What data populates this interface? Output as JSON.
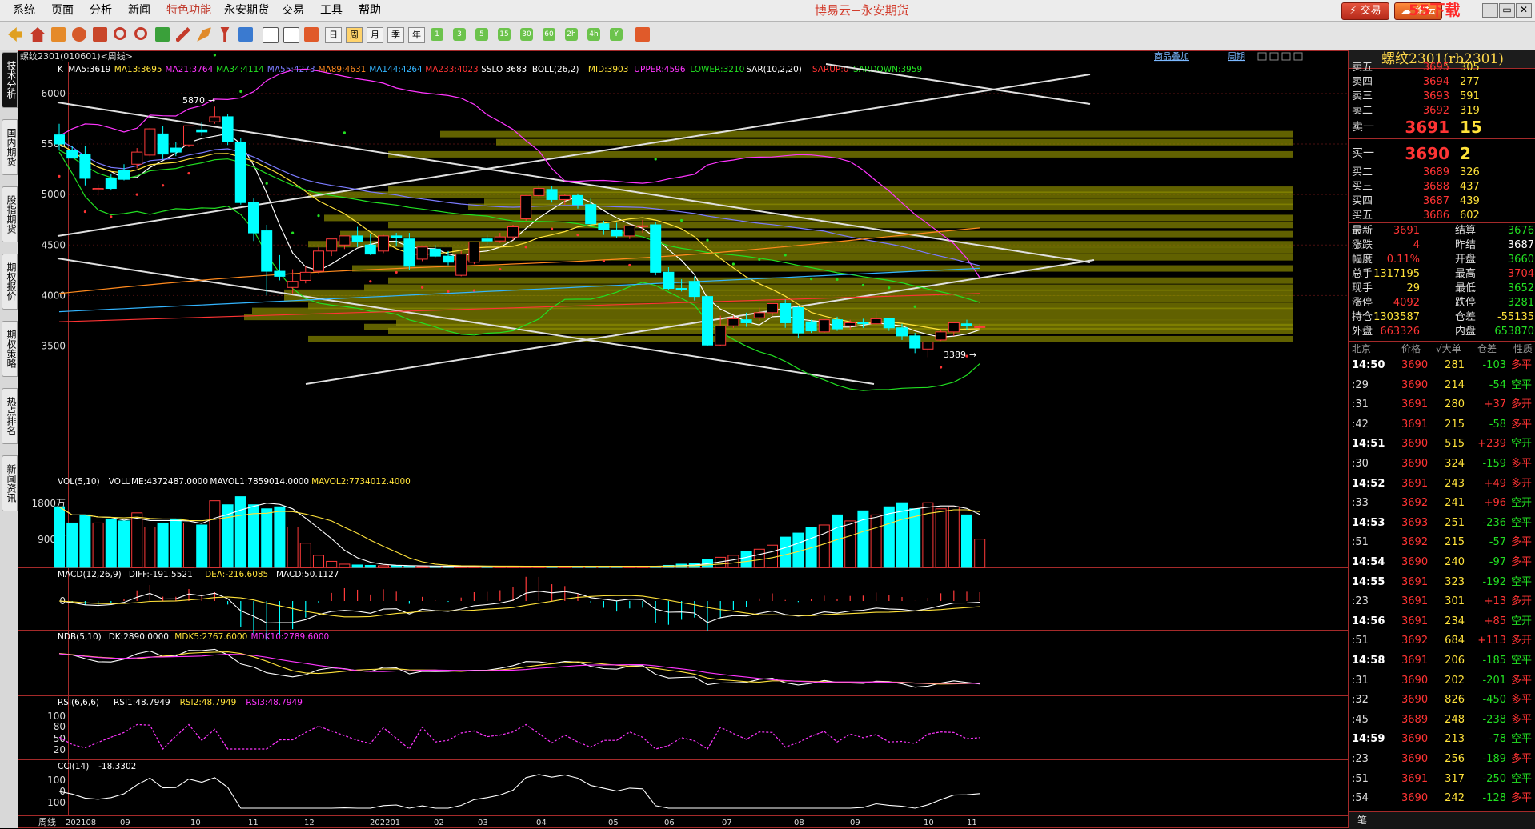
{
  "menu": {
    "items": [
      "系统",
      "页面",
      "分析",
      "新闻",
      "特色功能",
      "永安期货",
      "交易",
      "工具",
      "帮助"
    ],
    "title": "博易云−永安期货",
    "trade_btn": "交易",
    "forum_btn": "论坛",
    "watermark": "55下载 55etz.com"
  },
  "toolbar": {
    "periods": [
      "日",
      "周",
      "月",
      "季",
      "年",
      "1",
      "3",
      "5",
      "15",
      "30",
      "60",
      "2h",
      "4h",
      "Y"
    ]
  },
  "left_tabs": [
    "技术分析",
    "国内期货",
    "股指期货",
    "期权报价",
    "期权策略",
    "热点排名",
    "新闻资讯"
  ],
  "chart": {
    "symbol_title": "螺纹2301(010601)<周线>",
    "toplinks": [
      "商品叠加",
      "周期"
    ],
    "main_header": [
      {
        "t": "K",
        "c": "#ffffff"
      },
      {
        "t": "MA5:3619",
        "c": "#ffffff"
      },
      {
        "t": "MA13:3695",
        "c": "#ffe23a"
      },
      {
        "t": "MA21:3764",
        "c": "#ff35ff"
      },
      {
        "t": "MA34:4114",
        "c": "#22e022"
      },
      {
        "t": "MA55:4273",
        "c": "#7b7bff"
      },
      {
        "t": "MA89:4631",
        "c": "#ff8a1e"
      },
      {
        "t": "MA144:4264",
        "c": "#33b5ff"
      },
      {
        "t": "MA233:4023",
        "c": "#ff3434"
      },
      {
        "t": "SSLO 3683",
        "c": "#ffffff"
      },
      {
        "t": "BOLL(26,2)",
        "c": "#ffffff"
      },
      {
        "t": "MID:3903",
        "c": "#ffe23a"
      },
      {
        "t": "UPPER:4596",
        "c": "#ff35ff"
      },
      {
        "t": "LOWER:3210",
        "c": "#22e022"
      },
      {
        "t": "SAR(10,2,20)",
        "c": "#ffffff"
      },
      {
        "t": "SARUP:0",
        "c": "#ff3434"
      },
      {
        "t": "SARDOWN:3959",
        "c": "#22e022"
      }
    ],
    "price_ticks": [
      "6000",
      "5500",
      "5000",
      "4500",
      "4000",
      "3500"
    ],
    "annotations": {
      "high": "5870",
      "low": "3389"
    },
    "vol_header": [
      {
        "t": "VOL(5,10)",
        "c": "#ffffff"
      },
      {
        "t": "VOLUME:4372487.0000",
        "c": "#ffffff"
      },
      {
        "t": "MAVOL1:7859014.0000",
        "c": "#ffffff"
      },
      {
        "t": "MAVOL2:7734012.4000",
        "c": "#ffe23a"
      }
    ],
    "vol_ticks": [
      "1800万",
      "900万"
    ],
    "macd_header": [
      {
        "t": "MACD(12,26,9)",
        "c": "#ffffff"
      },
      {
        "t": "DIFF:-191.5521",
        "c": "#ffffff"
      },
      {
        "t": "DEA:-216.6085",
        "c": "#ffe23a"
      },
      {
        "t": "MACD:50.1127",
        "c": "#ffffff"
      }
    ],
    "macd_ticks": [
      "0"
    ],
    "ndb_header": [
      {
        "t": "NDB(5,10)",
        "c": "#ffffff"
      },
      {
        "t": "DK:2890.0000",
        "c": "#ffffff"
      },
      {
        "t": "MDK5:2767.6000",
        "c": "#ffe23a"
      },
      {
        "t": "MDK10:2789.6000",
        "c": "#ff35ff"
      }
    ],
    "rsi_header": [
      {
        "t": "RSI(6,6,6)",
        "c": "#ffffff"
      },
      {
        "t": "RSI1:48.7949",
        "c": "#ffffff"
      },
      {
        "t": "RSI2:48.7949",
        "c": "#ffe23a"
      },
      {
        "t": "RSI3:48.7949",
        "c": "#ff35ff"
      }
    ],
    "rsi_ticks": [
      "100",
      "80",
      "50",
      "20"
    ],
    "cci_header": [
      {
        "t": "CCI(14)",
        "c": "#ffffff"
      },
      {
        "t": "-18.3302",
        "c": "#ffffff"
      }
    ],
    "cci_ticks": [
      "100",
      "0",
      "-100"
    ],
    "period_label": "周线",
    "x_labels": [
      "202108",
      "09",
      "10",
      "11",
      "12",
      "202201",
      "02",
      "03",
      "04",
      "05",
      "06",
      "07",
      "08",
      "09",
      "10",
      "11"
    ]
  },
  "chart_data": {
    "type": "candlestick",
    "candles": [
      [
        5590,
        5700,
        5500,
        5440
      ],
      [
        5440,
        5480,
        5360,
        5380
      ],
      [
        5400,
        5480,
        5160,
        5090
      ],
      [
        5050,
        5100,
        5060,
        4990
      ],
      [
        5160,
        5200,
        5060,
        5040
      ],
      [
        5240,
        5300,
        5150,
        5140
      ],
      [
        5300,
        5460,
        5420,
        5260
      ],
      [
        5390,
        5660,
        5650,
        5370
      ],
      [
        5600,
        5680,
        5400,
        5350
      ],
      [
        5460,
        5520,
        5420,
        5380
      ],
      [
        5490,
        5660,
        5680,
        5470
      ],
      [
        5640,
        5720,
        5620,
        5580
      ],
      [
        5720,
        5870,
        5770,
        5700
      ],
      [
        5770,
        5800,
        5520,
        5490
      ],
      [
        5520,
        5560,
        4920,
        4900
      ],
      [
        4920,
        4960,
        4620,
        4540
      ],
      [
        4640,
        4700,
        4240,
        4000
      ],
      [
        4240,
        4400,
        4190,
        4150
      ],
      [
        4080,
        4260,
        4140,
        4020
      ],
      [
        4150,
        4290,
        4230,
        4120
      ],
      [
        4240,
        4480,
        4440,
        4220
      ],
      [
        4440,
        4500,
        4560,
        4390
      ],
      [
        4500,
        4560,
        4590,
        4460
      ],
      [
        4590,
        4680,
        4530,
        4480
      ],
      [
        4500,
        4610,
        4410,
        4400
      ],
      [
        4440,
        4600,
        4590,
        4420
      ],
      [
        4590,
        4620,
        4570,
        4490
      ],
      [
        4560,
        4620,
        4290,
        4250
      ],
      [
        4360,
        4460,
        4480,
        4340
      ],
      [
        4460,
        4500,
        4390,
        4380
      ],
      [
        4390,
        4440,
        4330,
        4300
      ],
      [
        4200,
        4440,
        4410,
        4190
      ],
      [
        4330,
        4460,
        4530,
        4310
      ],
      [
        4560,
        4600,
        4540,
        4500
      ],
      [
        4540,
        4620,
        4580,
        4520
      ],
      [
        4580,
        4700,
        4680,
        4550
      ],
      [
        4760,
        4800,
        4990,
        4740
      ],
      [
        4990,
        5100,
        5060,
        4960
      ],
      [
        5050,
        5080,
        4950,
        4920
      ],
      [
        4950,
        5000,
        4990,
        4900
      ],
      [
        4990,
        5010,
        4900,
        4860
      ],
      [
        4900,
        4960,
        4710,
        4680
      ],
      [
        4710,
        4740,
        4650,
        4600
      ],
      [
        4650,
        4720,
        4590,
        4570
      ],
      [
        4590,
        4680,
        4690,
        4560
      ],
      [
        4690,
        4750,
        4690,
        4620
      ],
      [
        4700,
        4730,
        4230,
        4200
      ],
      [
        4230,
        4280,
        4070,
        4050
      ],
      [
        4070,
        4160,
        4060,
        4040
      ],
      [
        4140,
        4190,
        3990,
        3950
      ],
      [
        3990,
        4000,
        3510,
        3500
      ],
      [
        3510,
        3800,
        3700,
        3500
      ],
      [
        3700,
        3800,
        3770,
        3680
      ],
      [
        3760,
        3830,
        3730,
        3690
      ],
      [
        3780,
        3880,
        3830,
        3750
      ],
      [
        3830,
        3890,
        3920,
        3800
      ],
      [
        3920,
        3960,
        3730,
        3680
      ],
      [
        3880,
        3900,
        3630,
        3580
      ],
      [
        3740,
        3760,
        3650,
        3630
      ],
      [
        3640,
        3710,
        3760,
        3630
      ],
      [
        3760,
        3790,
        3670,
        3650
      ],
      [
        3700,
        3760,
        3730,
        3660
      ],
      [
        3730,
        3770,
        3720,
        3680
      ],
      [
        3720,
        3840,
        3770,
        3710
      ],
      [
        3770,
        3780,
        3680,
        3650
      ],
      [
        3680,
        3720,
        3600,
        3560
      ],
      [
        3600,
        3630,
        3480,
        3430
      ],
      [
        3470,
        3520,
        3540,
        3389
      ],
      [
        3560,
        3660,
        3640,
        3550
      ],
      [
        3640,
        3740,
        3730,
        3600
      ],
      [
        3720,
        3760,
        3700,
        3660
      ],
      [
        3690,
        3720,
        3691,
        3660
      ]
    ],
    "volume_wan": [
      1500,
      1100,
      1300,
      1100,
      1200,
      1150,
      1350,
      1000,
      1100,
      1200,
      1100,
      1050,
      1650,
      1550,
      1750,
      1550,
      1450,
      1500,
      1000,
      600,
      300,
      150,
      80,
      60,
      50,
      40,
      40,
      30,
      30,
      30,
      30,
      30,
      30,
      30,
      30,
      30,
      30,
      30,
      30,
      30,
      30,
      30,
      30,
      30,
      30,
      30,
      30,
      50,
      80,
      100,
      200,
      250,
      300,
      400,
      450,
      550,
      750,
      850,
      1000,
      1050,
      1300,
      1150,
      1400,
      1300,
      1500,
      1600,
      1450,
      1600,
      1450,
      1500,
      1300,
      700
    ],
    "ylim": [
      3100,
      6300
    ],
    "x_start": "202108"
  },
  "rpanel": {
    "title": "螺纹2301(rb2301)",
    "asks": [
      {
        "n": "卖五",
        "p": "3695",
        "v": "305"
      },
      {
        "n": "卖四",
        "p": "3694",
        "v": "277"
      },
      {
        "n": "卖三",
        "p": "3693",
        "v": "591"
      },
      {
        "n": "卖二",
        "p": "3692",
        "v": "319"
      },
      {
        "n": "卖一",
        "p": "3691",
        "v": "15"
      }
    ],
    "bids": [
      {
        "n": "买一",
        "p": "3690",
        "v": "2"
      },
      {
        "n": "买二",
        "p": "3689",
        "v": "326"
      },
      {
        "n": "买三",
        "p": "3688",
        "v": "437"
      },
      {
        "n": "买四",
        "p": "3687",
        "v": "439"
      },
      {
        "n": "买五",
        "p": "3686",
        "v": "602"
      }
    ],
    "stats": [
      {
        "l1": "最新",
        "v1": "3691",
        "c1": "#ff3434",
        "l2": "结算",
        "v2": "3676",
        "c2": "#22e022"
      },
      {
        "l1": "涨跌",
        "v1": "4",
        "c1": "#ff3434",
        "l2": "昨结",
        "v2": "3687",
        "c2": "#ffffff"
      },
      {
        "l1": "幅度",
        "v1": "0.11%",
        "c1": "#ff3434",
        "l2": "开盘",
        "v2": "3660",
        "c2": "#22e022"
      },
      {
        "l1": "总手",
        "v1": "1317195",
        "c1": "#ffe23a",
        "l2": "最高",
        "v2": "3704",
        "c2": "#ff3434"
      },
      {
        "l1": "现手",
        "v1": "29",
        "c1": "#ffe23a",
        "l2": "最低",
        "v2": "3652",
        "c2": "#22e022"
      },
      {
        "l1": "涨停",
        "v1": "4092",
        "c1": "#ff3434",
        "l2": "跌停",
        "v2": "3281",
        "c2": "#22e022"
      },
      {
        "l1": "持仓",
        "v1": "1303587",
        "c1": "#ffe23a",
        "l2": "仓差",
        "v2": "-55135",
        "c2": "#ffe23a"
      },
      {
        "l1": "外盘",
        "v1": "663326",
        "c1": "#ff3434",
        "l2": "内盘",
        "v2": "653870",
        "c2": "#22e022"
      }
    ],
    "ts_header": [
      "北京",
      "价格",
      "√大单",
      "仓差",
      "性质"
    ],
    "ticks": [
      {
        "t": "14:50",
        "p": "3690",
        "v": "281",
        "oi": "-103",
        "ty": "多平",
        "full": true
      },
      {
        "t": ":29",
        "p": "3690",
        "v": "214",
        "oi": "-54",
        "ty": "空平",
        "full": false
      },
      {
        "t": ":31",
        "p": "3691",
        "v": "280",
        "oi": "+37",
        "ty": "多开",
        "full": false
      },
      {
        "t": ":42",
        "p": "3691",
        "v": "215",
        "oi": "-58",
        "ty": "多平",
        "full": false
      },
      {
        "t": "14:51",
        "p": "3690",
        "v": "515",
        "oi": "+239",
        "ty": "空开",
        "full": true
      },
      {
        "t": ":30",
        "p": "3690",
        "v": "324",
        "oi": "-159",
        "ty": "多平",
        "full": false
      },
      {
        "t": "14:52",
        "p": "3691",
        "v": "243",
        "oi": "+49",
        "ty": "多开",
        "full": true
      },
      {
        "t": ":33",
        "p": "3692",
        "v": "241",
        "oi": "+96",
        "ty": "空开",
        "full": false
      },
      {
        "t": "14:53",
        "p": "3693",
        "v": "251",
        "oi": "-236",
        "ty": "空平",
        "full": true
      },
      {
        "t": ":51",
        "p": "3692",
        "v": "215",
        "oi": "-57",
        "ty": "多平",
        "full": false
      },
      {
        "t": "14:54",
        "p": "3690",
        "v": "240",
        "oi": "-97",
        "ty": "多平",
        "full": true
      },
      {
        "t": "14:55",
        "p": "3691",
        "v": "323",
        "oi": "-192",
        "ty": "空平",
        "full": true
      },
      {
        "t": ":23",
        "p": "3691",
        "v": "301",
        "oi": "+13",
        "ty": "多开",
        "full": false
      },
      {
        "t": "14:56",
        "p": "3691",
        "v": "234",
        "oi": "+85",
        "ty": "空开",
        "full": true
      },
      {
        "t": ":51",
        "p": "3692",
        "v": "684",
        "oi": "+113",
        "ty": "多开",
        "full": false
      },
      {
        "t": "14:58",
        "p": "3691",
        "v": "206",
        "oi": "-185",
        "ty": "空平",
        "full": true
      },
      {
        "t": ":31",
        "p": "3690",
        "v": "202",
        "oi": "-201",
        "ty": "多平",
        "full": false
      },
      {
        "t": ":32",
        "p": "3690",
        "v": "826",
        "oi": "-450",
        "ty": "多平",
        "full": false
      },
      {
        "t": ":45",
        "p": "3689",
        "v": "248",
        "oi": "-238",
        "ty": "多平",
        "full": false
      },
      {
        "t": "14:59",
        "p": "3690",
        "v": "213",
        "oi": "-78",
        "ty": "空平",
        "full": true
      },
      {
        "t": ":23",
        "p": "3690",
        "v": "256",
        "oi": "-189",
        "ty": "多平",
        "full": false
      },
      {
        "t": ":51",
        "p": "3691",
        "v": "317",
        "oi": "-250",
        "ty": "空平",
        "full": false
      },
      {
        "t": ":54",
        "p": "3690",
        "v": "242",
        "oi": "-128",
        "ty": "多平",
        "full": false
      }
    ],
    "bottom_tab": "笔"
  }
}
